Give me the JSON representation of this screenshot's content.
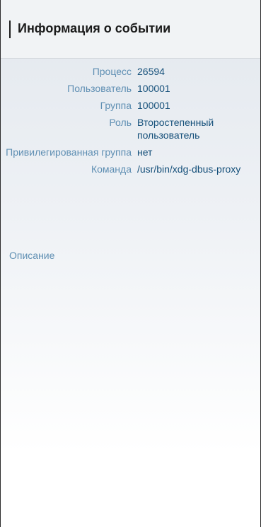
{
  "header": {
    "title": "Информация о событии"
  },
  "event_info": {
    "rows": [
      {
        "label": "Процесс",
        "value": "26594"
      },
      {
        "label": "Пользователь",
        "value": "100001"
      },
      {
        "label": "Группа",
        "value": "100001"
      },
      {
        "label": "Роль",
        "value": "Второстепенный пользователь"
      },
      {
        "label": "Привилегированная группа",
        "value": "нет"
      },
      {
        "label": "Команда",
        "value": "/usr/bin/xdg-dbus-proxy"
      }
    ]
  },
  "description": {
    "title": "Описание"
  }
}
